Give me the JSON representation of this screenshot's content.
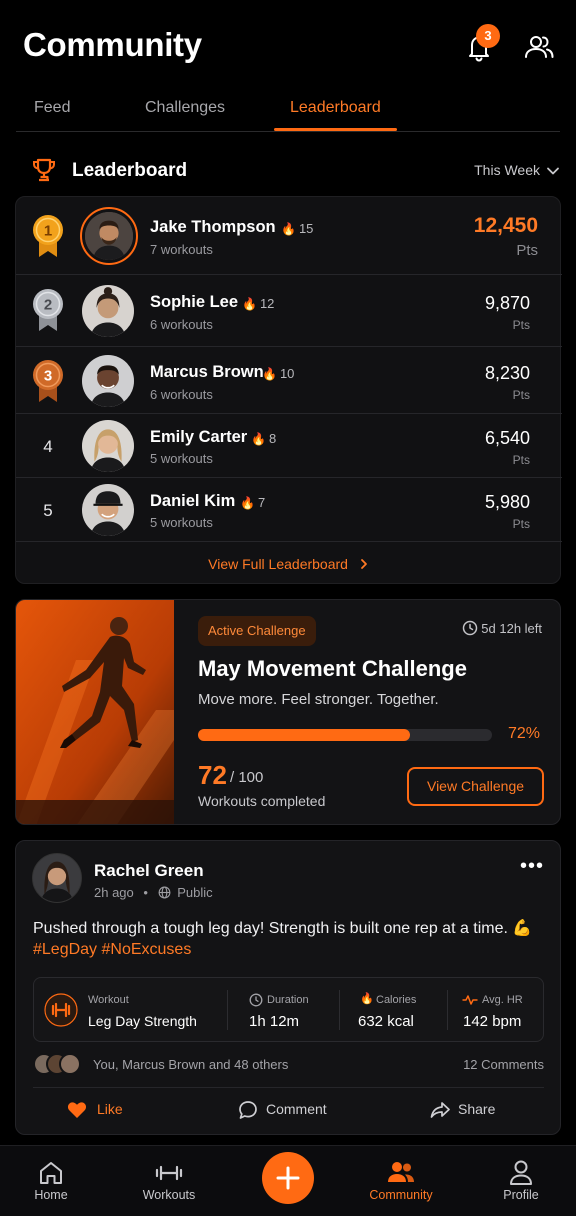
{
  "header": {
    "title": "Community",
    "notification_count": "3"
  },
  "tabs": [
    {
      "label": "Feed"
    },
    {
      "label": "Challenges"
    },
    {
      "label": "Leaderboard"
    }
  ],
  "leaderboard": {
    "title": "Leaderboard",
    "period": "This Week",
    "rows": [
      {
        "rank": "1",
        "name": "Jake Thompson",
        "streak": "15",
        "workouts": "7 workouts",
        "points": "12,450",
        "points_label": "Pts"
      },
      {
        "rank": "2",
        "name": "Sophie Lee",
        "streak": "12",
        "workouts": "6 workouts",
        "points": "9,870",
        "points_label": "Pts"
      },
      {
        "rank": "3",
        "name": "Marcus Brown",
        "streak": "10",
        "workouts": "6 workouts",
        "points": "8,230",
        "points_label": "Pts"
      },
      {
        "rank": "4",
        "name": "Emily Carter",
        "streak": "8",
        "workouts": "5 workouts",
        "points": "6,540",
        "points_label": "Pts"
      },
      {
        "rank": "5",
        "name": "Daniel Kim",
        "streak": "7",
        "workouts": "5 workouts",
        "points": "5,980",
        "points_label": "Pts"
      }
    ],
    "view_full": "View Full Leaderboard"
  },
  "challenge": {
    "badge": "Active Challenge",
    "time_left": "5d 12h left",
    "title": "May Movement Challenge",
    "subtitle": "Move more. Feel stronger. Together.",
    "progress_percent": 72,
    "progress_label": "72%",
    "count": "72",
    "total": "/ 100",
    "count_label": "Workouts completed",
    "button": "View Challenge"
  },
  "post": {
    "author": "Rachel Green",
    "time": "2h ago",
    "visibility": "Public",
    "text": "Pushed through a tough leg day! Strength is built one rep at a time. 💪",
    "tags": "#LegDay #NoExcuses",
    "stats": {
      "workout_label": "Workout",
      "workout_value": "Leg Day Strength",
      "duration_label": "Duration",
      "duration_value": "1h 12m",
      "calories_label": "Calories",
      "calories_value": "632 kcal",
      "hr_label": "Avg. HR",
      "hr_value": "142 bpm"
    },
    "likes_text": "You, Marcus Brown and 48 others",
    "comments_text": "12 Comments",
    "actions": {
      "like": "Like",
      "comment": "Comment",
      "share": "Share"
    }
  },
  "nav": [
    {
      "label": "Home"
    },
    {
      "label": "Workouts"
    },
    {
      "label": "Community"
    },
    {
      "label": "Profile"
    }
  ],
  "colors": {
    "accent": "#ff6a13",
    "background": "#000000",
    "card": "#111113",
    "gold": "#f2a21c",
    "silver": "#b9bcc2",
    "bronze": "#d06a28"
  }
}
